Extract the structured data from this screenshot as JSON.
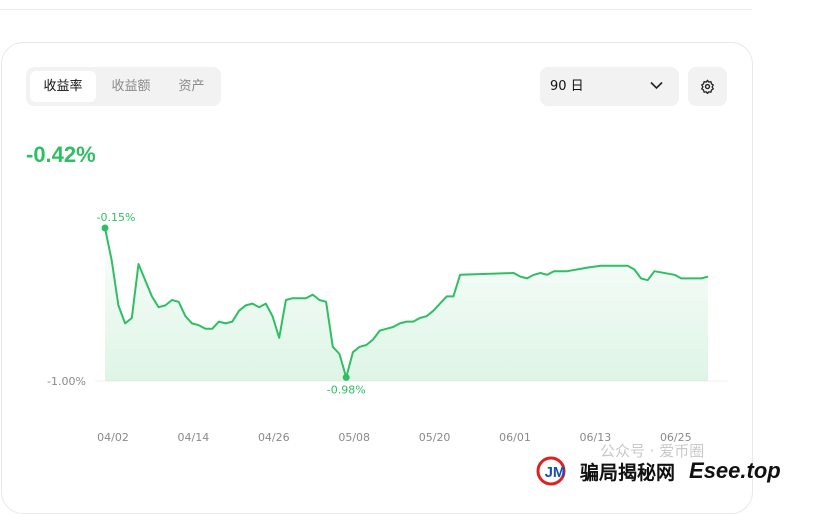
{
  "tabs": [
    {
      "label": "收益率",
      "active": true
    },
    {
      "label": "收益额",
      "active": false
    },
    {
      "label": "资产",
      "active": false
    }
  ],
  "period_select": {
    "value": "90 日",
    "icon": "chevron-down-icon"
  },
  "settings_icon": "gear-icon",
  "return_value": "-0.42%",
  "colors": {
    "accent": "#2fbf63",
    "text": "#111111",
    "muted": "#8a8a8a"
  },
  "chart_data": {
    "type": "area",
    "x_ticks": [
      "04/02",
      "04/14",
      "04/26",
      "05/08",
      "05/20",
      "06/01",
      "06/13",
      "06/25"
    ],
    "y_ticks": [
      "-1.00%"
    ],
    "ylim": [
      -1.0,
      -0.15
    ],
    "annotations": {
      "max": {
        "date": "04/02",
        "label": "-0.15%"
      },
      "min": {
        "date": "05/08",
        "label": "-0.98%"
      }
    },
    "points": [
      [
        "04/02",
        -0.15
      ],
      [
        "04/03",
        -0.33
      ],
      [
        "04/04",
        -0.58
      ],
      [
        "04/05",
        -0.68
      ],
      [
        "04/06",
        -0.65
      ],
      [
        "04/07",
        -0.35
      ],
      [
        "04/08",
        -0.44
      ],
      [
        "04/09",
        -0.53
      ],
      [
        "04/10",
        -0.59
      ],
      [
        "04/11",
        -0.58
      ],
      [
        "04/12",
        -0.55
      ],
      [
        "04/13",
        -0.56
      ],
      [
        "04/14",
        -0.64
      ],
      [
        "04/15",
        -0.68
      ],
      [
        "04/16",
        -0.69
      ],
      [
        "04/17",
        -0.71
      ],
      [
        "04/18",
        -0.71
      ],
      [
        "04/19",
        -0.67
      ],
      [
        "04/20",
        -0.68
      ],
      [
        "04/21",
        -0.67
      ],
      [
        "04/22",
        -0.61
      ],
      [
        "04/23",
        -0.58
      ],
      [
        "04/24",
        -0.57
      ],
      [
        "04/25",
        -0.59
      ],
      [
        "04/26",
        -0.57
      ],
      [
        "04/27",
        -0.64
      ],
      [
        "04/28",
        -0.76
      ],
      [
        "04/29",
        -0.55
      ],
      [
        "04/30",
        -0.54
      ],
      [
        "05/01",
        -0.54
      ],
      [
        "05/02",
        -0.54
      ],
      [
        "05/03",
        -0.52
      ],
      [
        "05/04",
        -0.55
      ],
      [
        "05/05",
        -0.56
      ],
      [
        "05/06",
        -0.81
      ],
      [
        "05/07",
        -0.85
      ],
      [
        "05/08",
        -0.98
      ],
      [
        "05/09",
        -0.84
      ],
      [
        "05/10",
        -0.81
      ],
      [
        "05/11",
        -0.8
      ],
      [
        "05/12",
        -0.77
      ],
      [
        "05/13",
        -0.72
      ],
      [
        "05/14",
        -0.71
      ],
      [
        "05/15",
        -0.7
      ],
      [
        "05/16",
        -0.68
      ],
      [
        "05/17",
        -0.67
      ],
      [
        "05/18",
        -0.67
      ],
      [
        "05/19",
        -0.65
      ],
      [
        "05/20",
        -0.64
      ],
      [
        "05/21",
        -0.61
      ],
      [
        "05/22",
        -0.57
      ],
      [
        "05/23",
        -0.53
      ],
      [
        "05/24",
        -0.53
      ],
      [
        "05/25",
        -0.41
      ],
      [
        "06/02",
        -0.4
      ],
      [
        "06/03",
        -0.42
      ],
      [
        "06/04",
        -0.43
      ],
      [
        "06/05",
        -0.41
      ],
      [
        "06/06",
        -0.4
      ],
      [
        "06/07",
        -0.41
      ],
      [
        "06/08",
        -0.39
      ],
      [
        "06/10",
        -0.39
      ],
      [
        "06/13",
        -0.37
      ],
      [
        "06/15",
        -0.36
      ],
      [
        "06/19",
        -0.36
      ],
      [
        "06/20",
        -0.38
      ],
      [
        "06/21",
        -0.43
      ],
      [
        "06/22",
        -0.44
      ],
      [
        "06/23",
        -0.39
      ],
      [
        "06/26",
        -0.41
      ],
      [
        "06/27",
        -0.43
      ],
      [
        "06/30",
        -0.43
      ],
      [
        "07/01",
        -0.42
      ]
    ]
  },
  "watermark": {
    "text": "公众号 · 爱币圈",
    "logo_mark": "JM",
    "logo_cn": "骗局揭秘网",
    "logo_en": "Esee.top"
  }
}
